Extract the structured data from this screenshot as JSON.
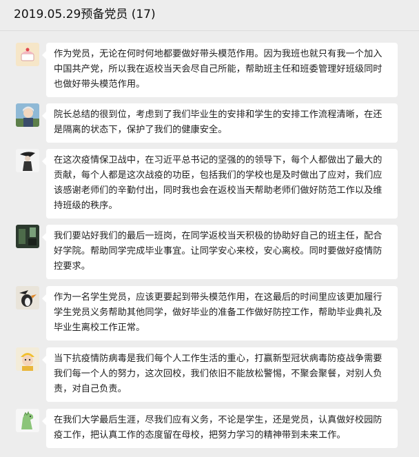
{
  "chat": {
    "title": "2019.05.29预备党员 (17)",
    "messages": [
      {
        "avatar_icon": "cake-avatar-icon",
        "text": "作为党员，无论在何时何地都要做好带头模范作用。因为我班也就只有我一个加入中国共产党，所以我在返校当天会尽自己所能，帮助班主任和班委管理好班级同时也做好带头模范作用。"
      },
      {
        "avatar_icon": "anime-character-avatar-icon",
        "text": "院长总结的很到位，考虑到了我们毕业生的安排和学生的安排工作流程清晰，在还是隔离的状态下，保护了我们的健康安全。"
      },
      {
        "avatar_icon": "ink-figure-avatar-icon",
        "text": "在这次疫情保卫战中，在习近平总书记的坚强的的领导下，每个人都做出了最大的贡献，每个人都是这次战疫的功臣，包括我们的学校也是及时做出了应对，我们应该感谢老师们的辛勤付出，同时我也会在返校当天帮助老师们做好防范工作以及维持班级的秩序。"
      },
      {
        "avatar_icon": "dark-scene-avatar-icon",
        "text": "我们要站好我们的最后一班岗，在同学返校当天积极的协助好自己的班主任，配合好学院。帮助同学完成毕业事宜。让同学安心来校，安心离校。同时要做好疫情防控要求。"
      },
      {
        "avatar_icon": "penguin-avatar-icon",
        "text": "作为一名学生党员，应该更要起到带头模范作用，在这最后的时间里应该更加履行学生党员义务帮助其他同学，做好毕业的准备工作做好防控工作，帮助毕业典礼及毕业生离校工作正常。"
      },
      {
        "avatar_icon": "baby-avatar-icon",
        "text": "当下抗疫情防病毒是我们每个人工作生活的重心，打赢新型冠状病毒防疫战争需要我们每一个人的努力，这次回校，我们依旧不能放松警惕，不聚会聚餐，对别人负责，对自己负责。"
      },
      {
        "avatar_icon": "dinosaur-avatar-icon",
        "text": "在我们大学最后生涯，尽我们应有义务，不论是学生，还是党员，认真做好校园防疫工作，把认真工作的态度留在母校，把努力学习的精神带到未来工作。"
      }
    ]
  }
}
